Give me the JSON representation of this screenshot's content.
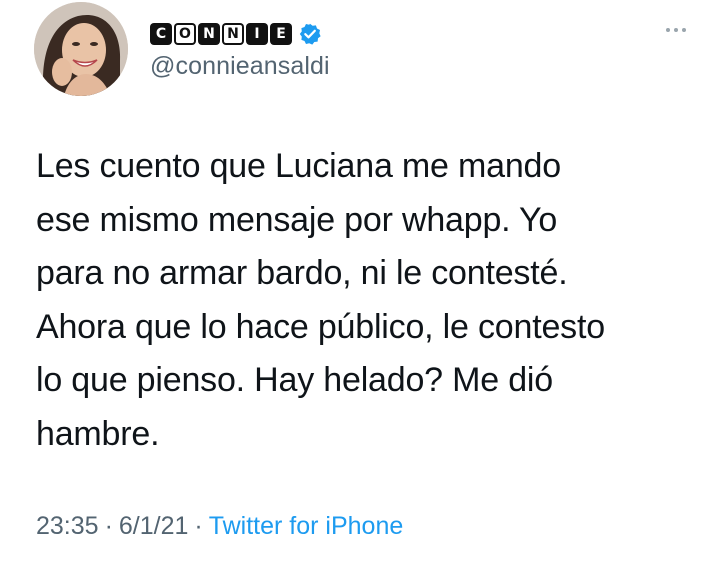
{
  "author": {
    "display_name_letters": [
      "C",
      "O",
      "N",
      "N",
      "I",
      "E"
    ],
    "display_name_styles": [
      "dark",
      "light",
      "dark",
      "light",
      "dark",
      "dark"
    ],
    "handle": "@connieansaldi",
    "verified_icon": "verified-badge-icon",
    "avatar_icon": "profile-avatar"
  },
  "tweet": {
    "lines": [
      "Les cuento que Luciana me mando",
      "ese mismo mensaje por whapp. Yo",
      "para no armar bardo, ni le contesté.",
      "Ahora que lo hace público, le contesto",
      "lo que pienso. Hay helado? Me dió",
      "hambre."
    ],
    "time": "23:35",
    "separator1": "·",
    "date": "6/1/21",
    "separator2": "·",
    "source": "Twitter for iPhone"
  },
  "menu": {
    "icon": "more-options-icon"
  },
  "colors": {
    "text": "#0f1419",
    "secondary": "#536471",
    "link": "#1d9bf0",
    "verified": "#1d9bf0"
  }
}
